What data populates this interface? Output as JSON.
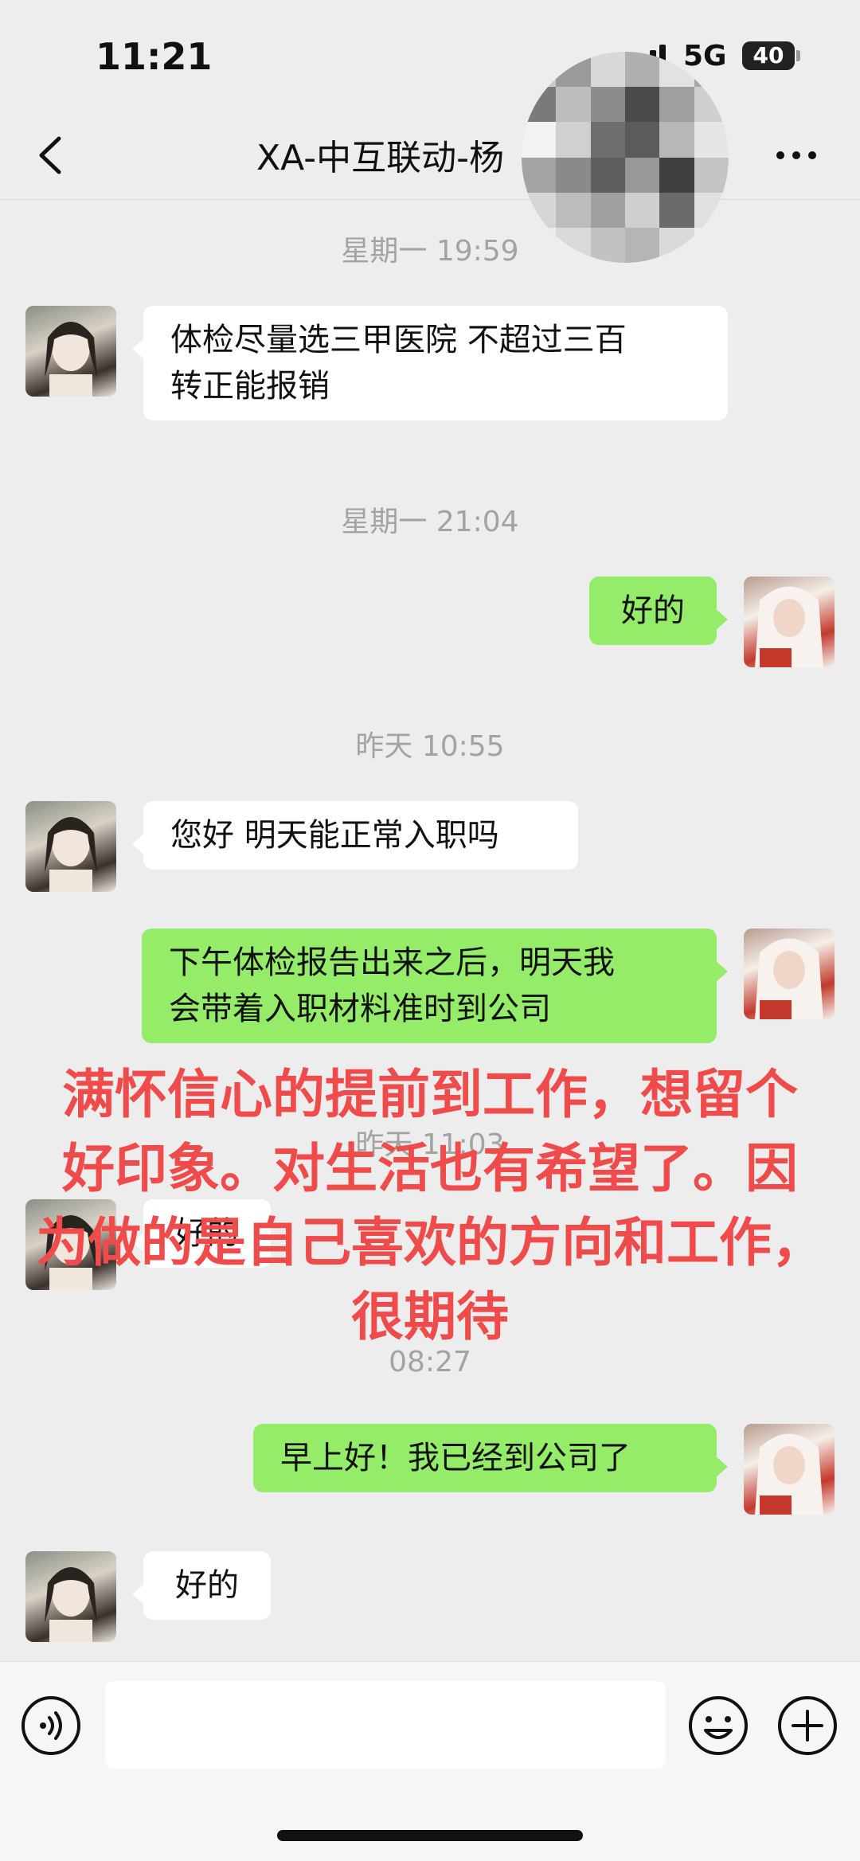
{
  "status_bar": {
    "time": "11:21",
    "network": "5G",
    "battery": "40"
  },
  "nav": {
    "title": "XA-中互联动-杨"
  },
  "messages": [
    {
      "type": "timestamp",
      "text": "星期一 19:59"
    },
    {
      "type": "message",
      "sender": "other",
      "lines": [
        "体检尽量选三甲医院 不超过三百",
        "转正能报销"
      ]
    },
    {
      "type": "timestamp",
      "text": "星期一 21:04"
    },
    {
      "type": "message",
      "sender": "self",
      "lines": [
        "好的"
      ]
    },
    {
      "type": "timestamp",
      "text": "昨天 10:55"
    },
    {
      "type": "message",
      "sender": "other",
      "lines": [
        "您好 明天能正常入职吗"
      ]
    },
    {
      "type": "message",
      "sender": "self",
      "lines": [
        "下午体检报告出来之后，明天我",
        "会带着入职材料准时到公司"
      ]
    },
    {
      "type": "timestamp",
      "text": "昨天 11:03"
    },
    {
      "type": "message",
      "sender": "other",
      "lines": [
        "好的"
      ]
    },
    {
      "type": "timestamp",
      "text": "08:27"
    },
    {
      "type": "message",
      "sender": "self",
      "lines": [
        "早上好！我已经到公司了"
      ]
    },
    {
      "type": "message",
      "sender": "other",
      "lines": [
        "好的"
      ]
    }
  ],
  "overlay_caption": {
    "lines": [
      "满怀信心的提前到工作，想留个",
      "好印象。对生活也有希望了。因",
      "为做的是自己喜欢的方向和工作，",
      "很期待"
    ],
    "color": "#ef4b4b"
  },
  "input_bar": {
    "placeholder": "",
    "icons": [
      "voice-icon",
      "emoji-icon",
      "plus-icon"
    ]
  },
  "colors": {
    "background": "#ededed",
    "self_bubble": "#95ec69",
    "other_bubble": "#ffffff"
  }
}
